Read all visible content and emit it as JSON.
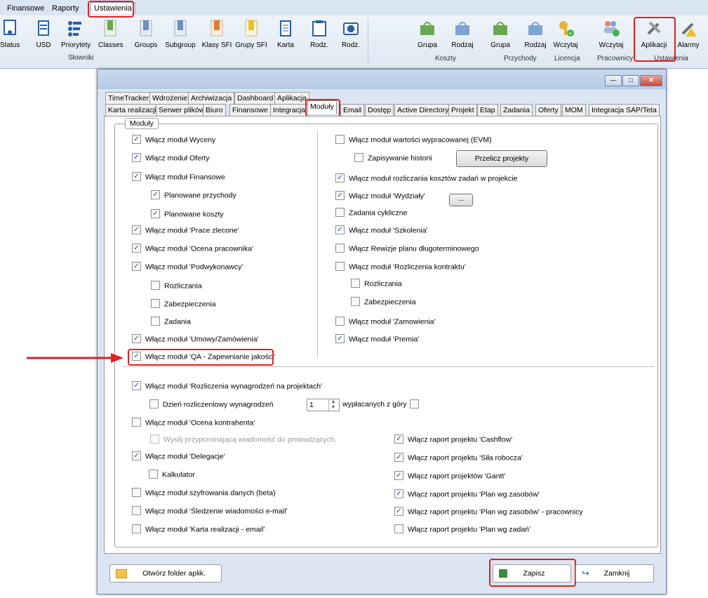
{
  "ribbon": {
    "tabs": [
      "Finansowe",
      "Raporty",
      "Ustawienia"
    ],
    "buttons": {
      "status": "Status",
      "usd": "USD",
      "priorytety": "Priorytety",
      "classes": "Classes",
      "groups": "Groups",
      "subgroup": "Subgroup",
      "klasy_sfi": "Klasy SFI",
      "grupy_sfi": "Grupy SFI",
      "karta": "Karta",
      "rodz1": "Rodz.",
      "rodz2": "Rodz.",
      "grupa_koszty": "Grupa",
      "rodzaj_koszty": "Rodzaj",
      "grupa_przychody": "Grupa",
      "rodzaj_przychody": "Rodzaj",
      "wczytaj_licencja_1": "Wczytaj",
      "wczytaj_licencja_2": "Licencja",
      "wczytaj_prac_1": "Wczytaj",
      "wczytaj_prac_2": "Pracownicy",
      "aplikacji": "Aplikacji",
      "alarmy": "Alarmy"
    },
    "groups": {
      "slowniki": "Słowniki",
      "koszty": "Koszty",
      "przychody": "Przychody",
      "ustawienia": "Ustawienia"
    }
  },
  "window": {
    "tabs_row1": [
      "TimeTracker",
      "Wdrożenie",
      "Archiwizacja",
      "Dashboard",
      "Aplikacja"
    ],
    "tabs_row2": [
      "Karta realizacji",
      "Serwer plików",
      "Biuro",
      "Finansowe",
      "Integracja",
      "Moduły",
      "Email",
      "Dostęp",
      "Active Directory",
      "Projekt",
      "Etap",
      "Zadania",
      "Oferty",
      "MOM",
      "Integracja SAP/Teta"
    ],
    "group_title": "Moduły",
    "left": [
      {
        "label": "Włącz moduł Wyceny",
        "checked": true
      },
      {
        "label": "Włącz moduł Oferty",
        "checked": true
      },
      {
        "label": "Włącz moduł Finansowe",
        "checked": true
      },
      {
        "label": "Planowane przychody",
        "checked": true
      },
      {
        "label": "Planowane koszty",
        "checked": true
      },
      {
        "label": "Włącz moduł 'Prace zlecone'",
        "checked": true
      },
      {
        "label": "Włącz moduł 'Ocena pracownika'",
        "checked": true
      },
      {
        "label": "Włącz moduł 'Podwykonawcy'",
        "checked": true
      },
      {
        "label": "Rozliczania",
        "checked": false
      },
      {
        "label": "Zabezpieczenia",
        "checked": false
      },
      {
        "label": "Zadania",
        "checked": false
      },
      {
        "label": "Włącz moduł 'Umowy/Zamówienia'",
        "checked": true
      },
      {
        "label": "Włącz moduł 'QA - Zapewnianie jakości'",
        "checked": true
      }
    ],
    "right": [
      {
        "label": "Włącz moduł wartości wypracowanej (EVM)",
        "checked": false
      },
      {
        "label": "Zapisywanie historii",
        "checked": false
      },
      {
        "label": "Włącz moduł rozliczania kosztów zadań w projekcie",
        "checked": true
      },
      {
        "label": "Włącz moduł 'Wydziały'",
        "checked": true
      },
      {
        "label": "Zadania cykliczne",
        "checked": false
      },
      {
        "label": "Włącz moduł 'Szkolenia'",
        "checked": true
      },
      {
        "label": "Włącz Rewizje planu długoterminowego",
        "checked": false
      },
      {
        "label": "Włącz moduł 'Rozliczenia kontraktu'",
        "checked": false
      },
      {
        "label": "Rozliczania",
        "checked": false
      },
      {
        "label": "Zabezpieczenia",
        "checked": false
      },
      {
        "label": "Włącz moduł 'Zamowienia'",
        "checked": false
      },
      {
        "label": "Włącz moduł 'Premia'",
        "checked": true
      }
    ],
    "przelicz_button": "Przelicz projekty",
    "dots_button": "...",
    "bottom_left": [
      {
        "label": "Włącz moduł 'Rozliczenia wynagrodzeń na projektach'",
        "checked": true
      },
      {
        "label": "Dzień rozliczeniowy wynagrodzeń",
        "checked": false
      },
      {
        "label": "Włącz moduł 'Ocena kontrahenta'",
        "checked": false
      },
      {
        "label": "Wyslij  przypominającą wiadomość do prowadzących.",
        "checked": false
      },
      {
        "label": "Włącz moduł 'Delegacje'",
        "checked": true
      },
      {
        "label": "Kalkulator",
        "checked": false
      },
      {
        "label": "Włącz moduł szyfrowania danych (beta)",
        "checked": false
      },
      {
        "label": "Włącz moduł 'Śledzenie wiadomości e-mail'",
        "checked": false
      },
      {
        "label": "Włącz moduł 'Karta realizacji - email'",
        "checked": false
      }
    ],
    "day_value": "1",
    "wyplacanych": "wypłacanych z góry",
    "bottom_right": [
      {
        "label": "Włącz raport projektu 'Cashflow'",
        "checked": true
      },
      {
        "label": "Włącz raport projektu 'Siła robocza'",
        "checked": true
      },
      {
        "label": "Włącz raport projektów 'Gantt'",
        "checked": true
      },
      {
        "label": "Włącz raport projektu 'Plan wg zasobów'",
        "checked": true
      },
      {
        "label": "Włącz raport projektu 'Plan wg zasobów' - pracownicy",
        "checked": true
      },
      {
        "label": "Włącz raport projektu 'Plan wg zadań'",
        "checked": false
      }
    ],
    "footer": {
      "open_folder": "Otwórz folder aplik.",
      "save": "Zapisz",
      "close": "Zamknij"
    }
  }
}
